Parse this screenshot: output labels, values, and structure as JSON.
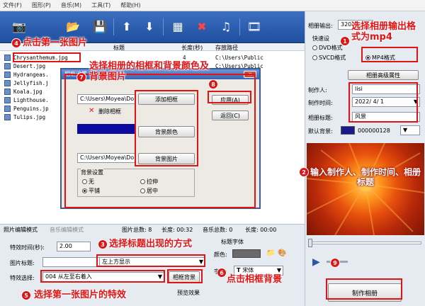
{
  "menu": [
    "文件(F)",
    "图形(P)",
    "音乐(M)",
    "工具(T)",
    "帮助(H)"
  ],
  "file_list": {
    "header_title": "标题",
    "header_length": "长度(秒)",
    "header_path": "存放路径",
    "files": [
      {
        "name": "Chrysanthemum.jpg",
        "length": "4",
        "path": "C:\\Users\\Public"
      },
      {
        "name": "Desert.jpg",
        "length": "4",
        "path": "C:\\Users\\Public"
      },
      {
        "name": "Hydrangeas.",
        "length": "",
        "path": ""
      },
      {
        "name": "Jellyfish.j",
        "length": "",
        "path": ""
      },
      {
        "name": "Koala.jpg",
        "length": "",
        "path": ""
      },
      {
        "name": "Lighthouse.",
        "length": "",
        "path": ""
      },
      {
        "name": "Penguins.jp",
        "length": "",
        "path": ""
      },
      {
        "name": "Tulips.jpg",
        "length": "",
        "path": ""
      }
    ]
  },
  "dialog": {
    "title": "相框设置",
    "path1": "C:\\Users\\Moyea\\Do",
    "delete_frame": "删除相框",
    "path2": "C:\\Users\\Moyea\\Do",
    "add_frame": "添加相框",
    "bg_color": "背景颜色",
    "bg_image": "背景图片",
    "bg_settings": "背景设置",
    "opt_none": "无",
    "opt_stretch": "拉伸",
    "opt_tile": "平铺",
    "opt_center": "居中",
    "apply": "应用(A)",
    "back": "返回(C)",
    "frame_color": "#1212a0"
  },
  "tabs": {
    "photo": "照片编辑模式",
    "music": "音乐编辑模式"
  },
  "status": {
    "photo_total": "图片总数: 8",
    "length": "长度: 00:32",
    "music_total": "音乐总数: 0",
    "length2": "长度: 00:00"
  },
  "effects": {
    "time_label": "特效时间(秒):",
    "time_value": "2.00",
    "title_label": "图片标题:",
    "title_value": "左上方显示",
    "effect_label": "特效选择:",
    "effect_value": "004 从左至右着入",
    "frame_bg_btn": "相框背景",
    "title_font": "标题字体",
    "color_label": "颜色:",
    "font_label": "字体:",
    "font_value": "宋体",
    "bottom_cut": "预览效果"
  },
  "right": {
    "output_label": "相册输出:",
    "output_value": "320x",
    "quick_settings": "快速设",
    "fmt_dvd": "DVD格式",
    "fmt_svcd": "SVCD格式",
    "fmt_mp4": "MP4格式",
    "advanced": "相册高级属性",
    "author_label": "制作人:",
    "author_value": "lisi",
    "date_label": "制作时间:",
    "date_value": "2022/ 4/ 1",
    "album_title_label": "相册标题:",
    "album_title_value": "风景",
    "default_bg_label": "默认背景:",
    "default_bg_value": "000000128",
    "make_album": "制作相册"
  },
  "annotations": {
    "a1": "选择相册输出格式为mp4",
    "a2": "输入制作人、制作时间、相册标题",
    "a3": "选择标题出现的方式",
    "a4": "点击第一张图片",
    "a5": "选择第一张图片的特效",
    "a6": "点击相框背景",
    "a7": "选择相册的相框和背景颜色及背景图片",
    "a8": "",
    "a9": "",
    "n1": "1",
    "n2": "2",
    "n3": "3",
    "n4": "4",
    "n5": "5",
    "n6": "6",
    "n7": "7",
    "n8": "8",
    "n9": "9"
  },
  "colors": {
    "annotation_red": "#e01414",
    "toolbar_blue": "#2a5cac"
  }
}
